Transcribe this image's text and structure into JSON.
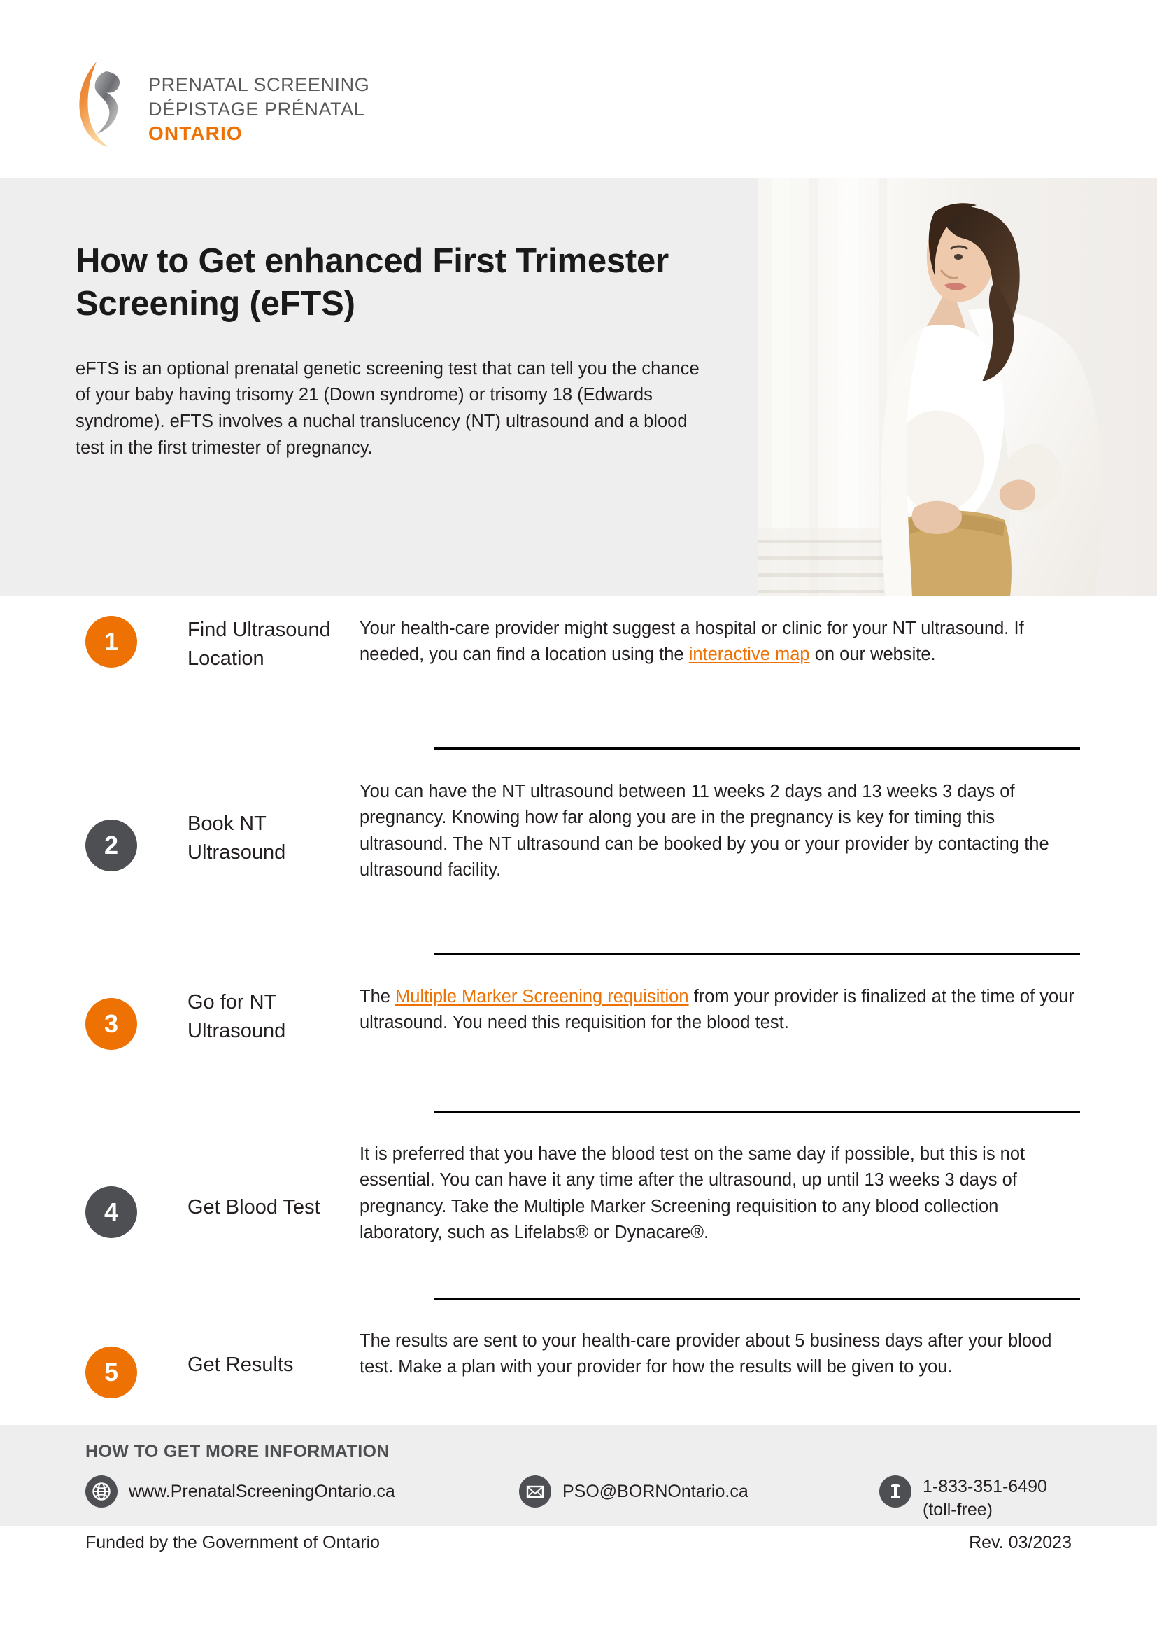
{
  "logo": {
    "line1": "PRENATAL SCREENING",
    "line2": "DÉPISTAGE PRÉNATAL",
    "line3": "ONTARIO",
    "mark_name": "pso-swoosh-logo",
    "orange": "#ED7203",
    "grey": "#58595B"
  },
  "hero": {
    "title": "How to Get enhanced First Trimester Screening (eFTS)",
    "body": "eFTS is  an optional prenatal genetic screening test that can tell you the chance of your baby having trisomy 21 (Down syndrome) or trisomy 18 (Edwards syndrome). eFTS involves a nuchal translucency (NT) ultrasound and a blood test in the first trimester of pregnancy.",
    "photo_alt": "pregnant-person-photo",
    "background": "#EEEEEE"
  },
  "steps": [
    {
      "number": "1",
      "badge_color": "orange",
      "label": "Find Ultrasound Location",
      "body_before": "Your health-care provider might suggest a hospital or clinic for your NT ultrasound. If needed, you can find a location using the ",
      "link": "interactive map",
      "body_after": " on our website."
    },
    {
      "number": "2",
      "badge_color": "grey",
      "label": "Book NT Ultrasound",
      "body_before": "You can have the NT ultrasound between 11 weeks 2 days and 13 weeks 3 days of pregnancy. Knowing how far along you are in the pregnancy is key for timing this ultrasound. The NT ultrasound can be booked by you or your provider by contacting the ultrasound facility.",
      "link": "",
      "body_after": ""
    },
    {
      "number": "3",
      "badge_color": "orange",
      "label": "Go for NT Ultrasound",
      "body_before": "The ",
      "link": "Multiple Marker Screening requisition",
      "body_after": " from your provider is finalized at the time of your ultrasound. You need this requisition for the blood test."
    },
    {
      "number": "4",
      "badge_color": "grey",
      "label": "Get Blood Test",
      "body_before": "It is preferred that you have the blood test on the same day if possible, but this is not essential. You can have it any time after the ultrasound, up until 13 weeks 3 days of pregnancy. Take the Multiple Marker Screening requisition to any blood collection laboratory, such as Lifelabs® or Dynacare®.",
      "link": "",
      "body_after": ""
    },
    {
      "number": "5",
      "badge_color": "orange",
      "label": "Get Results",
      "body_before": "The results are sent to your health-care provider about 5 business days after your blood test. Make a plan with your provider for how the results will be given to you.",
      "link": "",
      "body_after": ""
    }
  ],
  "contact": {
    "heading": "HOW TO GET MORE INFORMATION",
    "website_icon": "globe-icon",
    "website": "www.PrenatalScreeningOntario.ca",
    "email_icon": "envelope-icon",
    "email": "PSO@BORNOntario.ca",
    "phone_icon": "telephone-icon",
    "phone": "1-833-351-6490",
    "phone_note": "(toll-free)",
    "icon_color": "#4D4F52",
    "background": "#EEEEEE"
  },
  "bottom": {
    "funding": "Funded by the Government of Ontario",
    "revision": "Rev. 03/2023"
  }
}
